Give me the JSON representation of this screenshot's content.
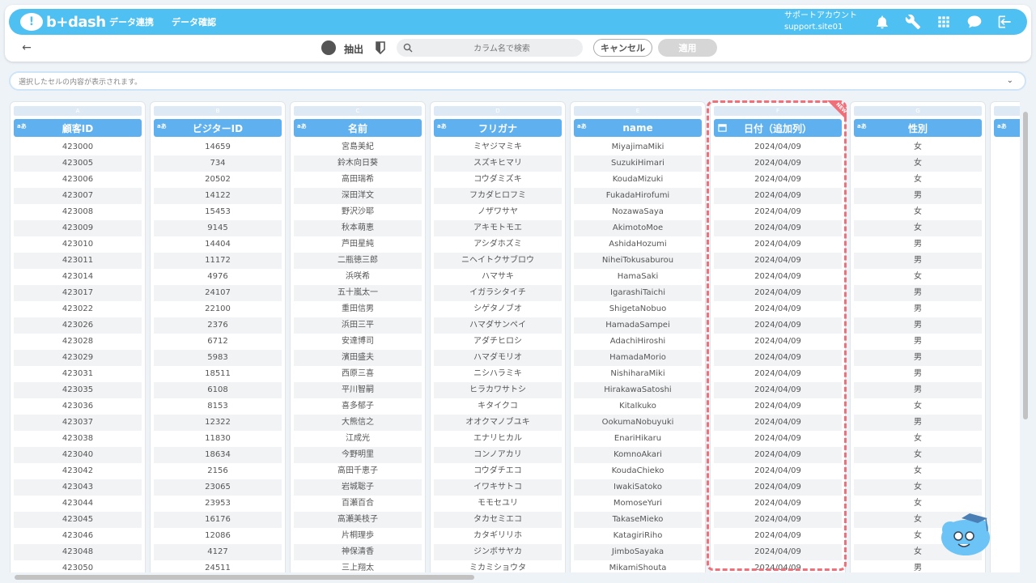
{
  "nav": {
    "logo_text": "b+dash",
    "links": [
      "データ連携",
      "データ確認"
    ],
    "account_name": "サポートアカウント",
    "account_id": "support.site01"
  },
  "toolbar": {
    "extract_label": "抽出",
    "search_placeholder": "カラム名で検索",
    "cancel_label": "キャンセル",
    "apply_label": "適用"
  },
  "cellbar": {
    "placeholder": "選択したセルの内容が表示されます。"
  },
  "columns": [
    {
      "letter": "A",
      "title": "顧客ID",
      "type": "aあ",
      "values": [
        "423000",
        "423005",
        "423006",
        "423007",
        "423008",
        "423009",
        "423010",
        "423011",
        "423014",
        "423017",
        "423022",
        "423026",
        "423028",
        "423029",
        "423031",
        "423035",
        "423036",
        "423037",
        "423038",
        "423040",
        "423042",
        "423043",
        "423044",
        "423045",
        "423046",
        "423048",
        "423050"
      ]
    },
    {
      "letter": "B",
      "title": "ビジターID",
      "type": "aあ",
      "values": [
        "14659",
        "734",
        "20502",
        "14122",
        "15453",
        "9145",
        "14404",
        "11172",
        "4976",
        "24107",
        "22100",
        "2376",
        "6712",
        "5983",
        "18511",
        "6108",
        "8153",
        "12322",
        "11830",
        "18634",
        "2156",
        "23065",
        "23953",
        "16176",
        "12086",
        "4127",
        "24511"
      ]
    },
    {
      "letter": "C",
      "title": "名前",
      "type": "aあ",
      "values": [
        "宮島美紀",
        "鈴木向日葵",
        "高田瑞希",
        "深田洋文",
        "野沢沙耶",
        "秋本萌恵",
        "芦田星純",
        "二瓶徳三郎",
        "浜咲希",
        "五十嵐太一",
        "重田信男",
        "浜田三平",
        "安達博司",
        "濱田盛夫",
        "西原三喜",
        "平川智嗣",
        "喜多郁子",
        "大熊信之",
        "江成光",
        "今野明里",
        "高田千恵子",
        "岩城聡子",
        "百瀬百合",
        "高瀬美枝子",
        "片桐理歩",
        "神保清香",
        "三上翔太"
      ]
    },
    {
      "letter": "D",
      "title": "フリガナ",
      "type": "aあ",
      "values": [
        "ミヤジマミキ",
        "スズキヒマリ",
        "コウダミズキ",
        "フカダヒロフミ",
        "ノザワサヤ",
        "アキモトモエ",
        "アシダホズミ",
        "ニヘイトクサブロウ",
        "ハマサキ",
        "イガラシタイチ",
        "シゲタノブオ",
        "ハマダサンペイ",
        "アダチヒロシ",
        "ハマダモリオ",
        "ニシハラミキ",
        "ヒラカワサトシ",
        "キタイクコ",
        "オオクマノブユキ",
        "エナリヒカル",
        "コンノアカリ",
        "コウダチエコ",
        "イワキサトコ",
        "モモセユリ",
        "タカセミエコ",
        "カタギリリホ",
        "ジンボサヤカ",
        "ミカミショウタ"
      ]
    },
    {
      "letter": "E",
      "title": "name",
      "type": "aあ",
      "values": [
        "MiyajimaMiki",
        "SuzukiHimari",
        "KoudaMizuki",
        "FukadaHirofumi",
        "NozawaSaya",
        "AkimotoMoe",
        "AshidaHozumi",
        "NiheiTokusaburou",
        "HamaSaki",
        "IgarashiTaichi",
        "ShigetaNobuo",
        "HamadaSampei",
        "AdachiHiroshi",
        "HamadaMorio",
        "NishiharaMiki",
        "HirakawaSatoshi",
        "KitaIkuko",
        "OokumaNobuyuki",
        "EnariHikaru",
        "KomnoAkari",
        "KoudaChieko",
        "IwakiSatoko",
        "MomoseYuri",
        "TakaseMieko",
        "KatagiriRiho",
        "JimboSayaka",
        "MikamiShouta"
      ]
    },
    {
      "letter": "F",
      "title": "日付（追加列）",
      "type": "calendar",
      "ribbon": "NEW",
      "values": [
        "2024/04/09",
        "2024/04/09",
        "2024/04/09",
        "2024/04/09",
        "2024/04/09",
        "2024/04/09",
        "2024/04/09",
        "2024/04/09",
        "2024/04/09",
        "2024/04/09",
        "2024/04/09",
        "2024/04/09",
        "2024/04/09",
        "2024/04/09",
        "2024/04/09",
        "2024/04/09",
        "2024/04/09",
        "2024/04/09",
        "2024/04/09",
        "2024/04/09",
        "2024/04/09",
        "2024/04/09",
        "2024/04/09",
        "2024/04/09",
        "2024/04/09",
        "2024/04/09",
        "2024/04/09"
      ]
    },
    {
      "letter": "G",
      "title": "性別",
      "type": "aあ",
      "values": [
        "女",
        "女",
        "女",
        "男",
        "女",
        "女",
        "男",
        "男",
        "女",
        "男",
        "男",
        "男",
        "男",
        "男",
        "男",
        "男",
        "女",
        "男",
        "女",
        "女",
        "女",
        "女",
        "女",
        "女",
        "女",
        "女",
        "男"
      ]
    },
    {
      "letter": "H",
      "title": "",
      "type": "aあ",
      "values": []
    }
  ],
  "colors": {
    "accent": "#4ec0f2",
    "header": "#5fb0ef",
    "highlight": "#f0707a"
  }
}
